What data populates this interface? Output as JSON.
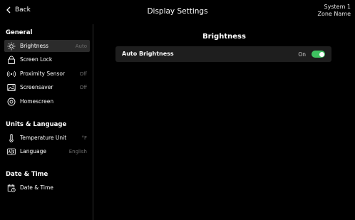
{
  "header": {
    "back_label": "Back",
    "title": "Display Settings",
    "system_line1": "System 1",
    "system_line2": "Zone Name"
  },
  "sidebar": {
    "groups": [
      {
        "title": "General",
        "items": [
          {
            "label": "Brightness",
            "value": "Auto",
            "icon": "sun-icon",
            "active": true
          },
          {
            "label": "Screen Lock",
            "value": "",
            "icon": "lock-icon"
          },
          {
            "label": "Proximity Sensor",
            "value": "Off",
            "icon": "proximity-icon"
          },
          {
            "label": "Screensaver",
            "value": "Off",
            "icon": "screensaver-icon"
          },
          {
            "label": "Homescreen",
            "value": "",
            "icon": "eye-icon"
          }
        ]
      },
      {
        "title": "Units & Language",
        "items": [
          {
            "label": "Temperature Unit",
            "value": "°F",
            "icon": "thermometer-icon"
          },
          {
            "label": "Language",
            "value": "English",
            "icon": "language-icon"
          }
        ]
      },
      {
        "title": "Date & Time",
        "items": [
          {
            "label": "Date & Time",
            "value": "",
            "icon": "calendar-clock-icon"
          }
        ]
      }
    ]
  },
  "main": {
    "title": "Brightness",
    "setting": {
      "label": "Auto Brightness",
      "status": "On",
      "toggle_on": true,
      "toggle_color": "#3ec160"
    }
  }
}
